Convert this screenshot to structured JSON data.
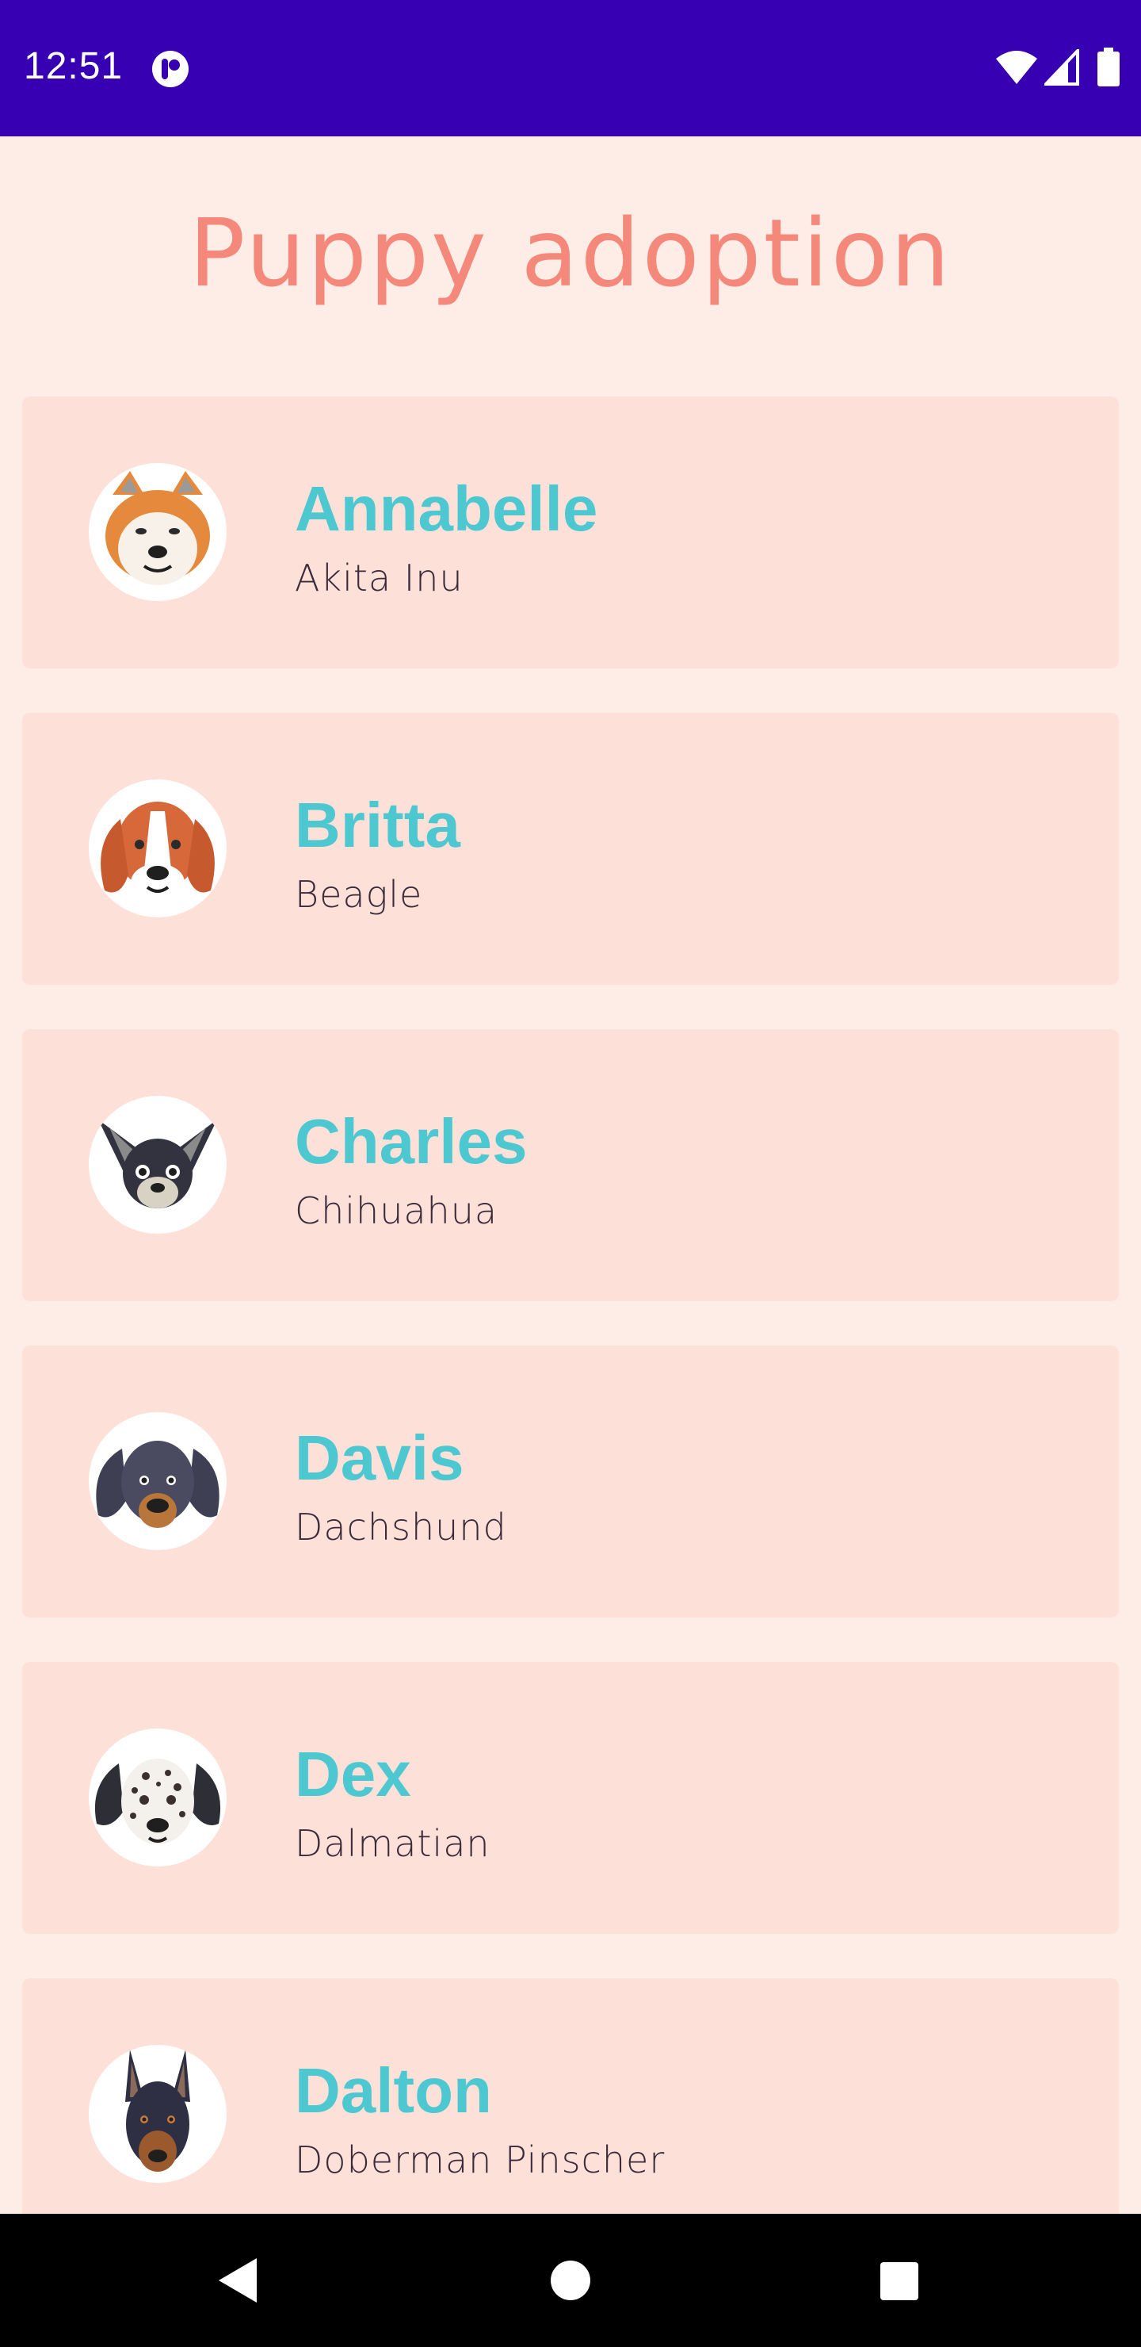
{
  "status_bar": {
    "time": "12:51",
    "background": "#3700b3",
    "icons": [
      "app-notification-icon",
      "wifi-icon",
      "cell-signal-icon",
      "battery-icon"
    ]
  },
  "app": {
    "title": "Puppy adoption",
    "title_color": "#f4897b",
    "background": "#fdede6",
    "card_color": "#fde0d8",
    "name_color": "#4dc8d1"
  },
  "puppies": [
    {
      "name": "Annabelle",
      "breed": "Akita Inu",
      "avatar": "akita-icon"
    },
    {
      "name": "Britta",
      "breed": "Beagle",
      "avatar": "beagle-icon"
    },
    {
      "name": "Charles",
      "breed": "Chihuahua",
      "avatar": "chihuahua-icon"
    },
    {
      "name": "Davis",
      "breed": "Dachshund",
      "avatar": "dachshund-icon"
    },
    {
      "name": "Dex",
      "breed": "Dalmatian",
      "avatar": "dalmatian-icon"
    },
    {
      "name": "Dalton",
      "breed": "Doberman Pinscher",
      "avatar": "doberman-icon"
    }
  ],
  "nav_bar": {
    "buttons": [
      "back-icon",
      "home-icon",
      "recents-icon"
    ]
  }
}
